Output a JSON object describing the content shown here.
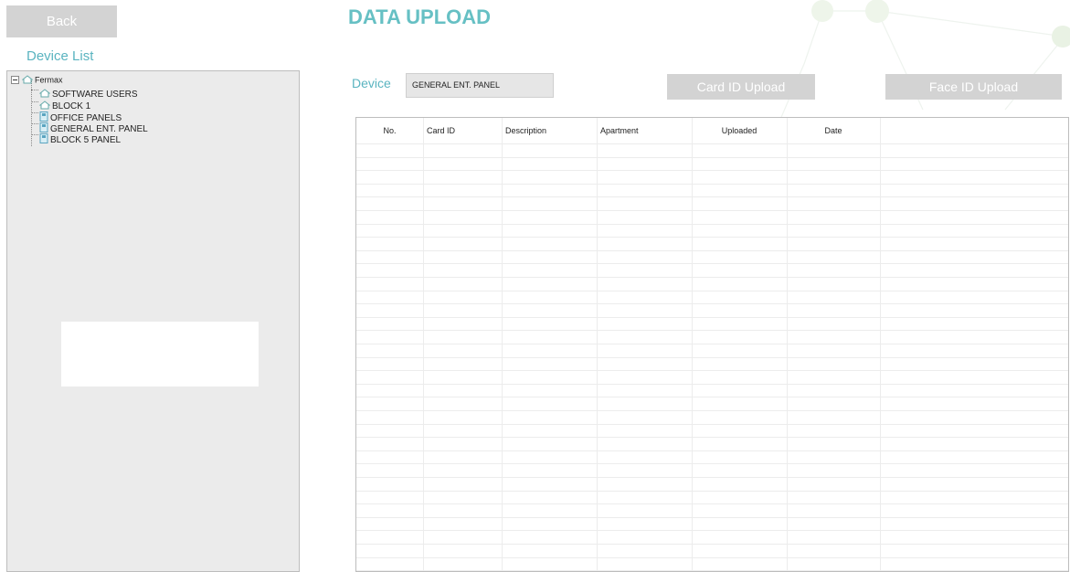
{
  "header": {
    "back_label": "Back",
    "title": "DATA UPLOAD"
  },
  "sidebar": {
    "label": "Device List",
    "root": "Fermax",
    "items": [
      {
        "label": "SOFTWARE USERS",
        "icon": "house-icon"
      },
      {
        "label": "BLOCK 1",
        "icon": "house-icon"
      },
      {
        "label": "OFFICE PANELS",
        "icon": "panel-icon"
      },
      {
        "label": "GENERAL ENT. PANEL",
        "icon": "panel-icon"
      },
      {
        "label": "BLOCK 5 PANEL",
        "icon": "panel-icon"
      }
    ]
  },
  "device": {
    "label": "Device",
    "value": "GENERAL ENT. PANEL"
  },
  "toolbar": {
    "card_upload": "Card ID Upload",
    "face_upload": "Face ID Upload"
  },
  "table": {
    "columns": [
      "No.",
      "Card ID",
      "Description",
      "Apartment",
      "Uploaded",
      "Date"
    ],
    "rows": []
  },
  "colors": {
    "accent": "#66c0c4",
    "button": "#d3d3d3",
    "panel": "#ebebeb"
  }
}
